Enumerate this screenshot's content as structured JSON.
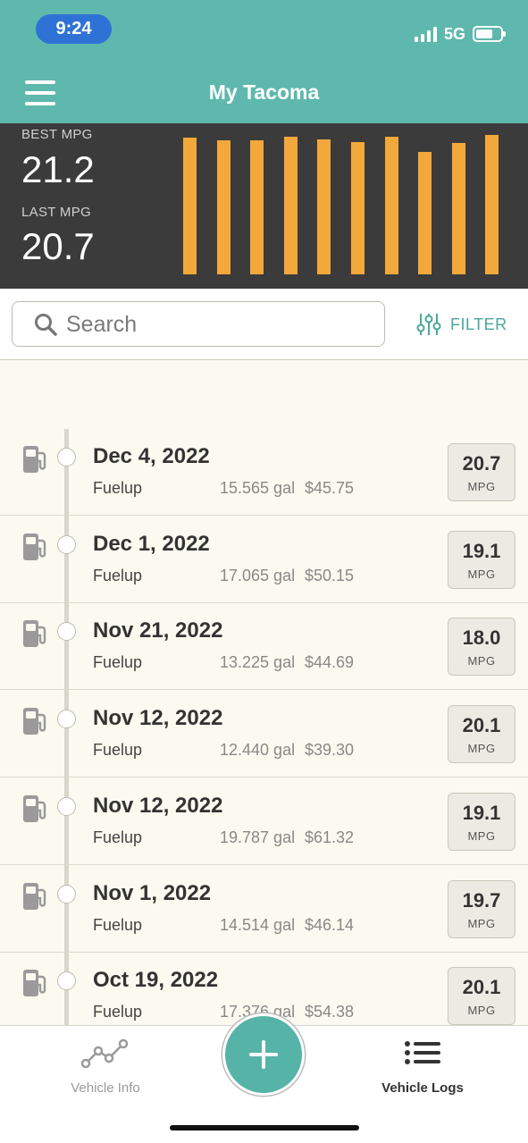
{
  "status_bar": {
    "time": "9:24",
    "network": "5G"
  },
  "header": {
    "title": "My Tacoma"
  },
  "summary": {
    "best_label": "BEST MPG",
    "best_value": "21.2",
    "last_label": "LAST MPG",
    "last_value": "20.7",
    "bar_color": "#f2a83a",
    "bar_levels": [
      0.98,
      0.96,
      0.96,
      0.99,
      0.97,
      0.95,
      0.99,
      0.88,
      0.94,
      1.0
    ]
  },
  "search": {
    "placeholder": "Search",
    "filter_label": "FILTER"
  },
  "logs": [
    {
      "date": "Dec 4, 2022",
      "type": "Fuelup",
      "gallons": "15.565 gal",
      "cost": "$45.75",
      "mpg": "20.7",
      "unit": "MPG"
    },
    {
      "date": "Dec 1, 2022",
      "type": "Fuelup",
      "gallons": "17.065 gal",
      "cost": "$50.15",
      "mpg": "19.1",
      "unit": "MPG"
    },
    {
      "date": "Nov 21, 2022",
      "type": "Fuelup",
      "gallons": "13.225 gal",
      "cost": "$44.69",
      "mpg": "18.0",
      "unit": "MPG"
    },
    {
      "date": "Nov 12, 2022",
      "type": "Fuelup",
      "gallons": "12.440 gal",
      "cost": "$39.30",
      "mpg": "20.1",
      "unit": "MPG"
    },
    {
      "date": "Nov 12, 2022",
      "type": "Fuelup",
      "gallons": "19.787 gal",
      "cost": "$61.32",
      "mpg": "19.1",
      "unit": "MPG"
    },
    {
      "date": "Nov 1, 2022",
      "type": "Fuelup",
      "gallons": "14.514 gal",
      "cost": "$46.14",
      "mpg": "19.7",
      "unit": "MPG"
    },
    {
      "date": "Oct 19, 2022",
      "type": "Fuelup",
      "gallons": "17.376 gal",
      "cost": "$54.38",
      "mpg": "20.1",
      "unit": "MPG"
    }
  ],
  "tabs": {
    "info_label": "Vehicle Info",
    "logs_label": "Vehicle Logs",
    "active": "Vehicle Logs"
  },
  "colors": {
    "accent": "#5fb8ad",
    "dark_panel": "#3b3b3b",
    "list_bg": "#fbfaf0"
  }
}
